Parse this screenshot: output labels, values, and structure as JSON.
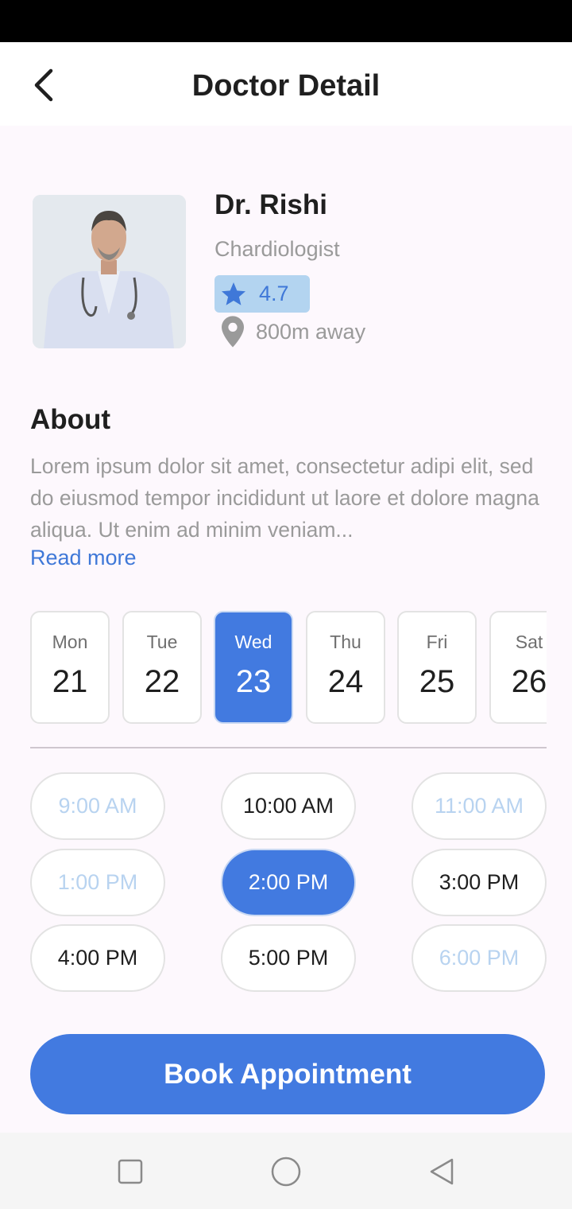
{
  "app_bar": {
    "title": "Doctor Detail",
    "back_icon": "chevron-left-icon"
  },
  "doctor": {
    "name": "Dr. Rishi",
    "specialty": "Chardiologist",
    "rating": "4.7",
    "distance": "800m away",
    "icons": {
      "rating": "star-icon",
      "distance": "location-pin-icon"
    }
  },
  "about": {
    "title": "About",
    "text": "Lorem ipsum dolor sit amet, consectetur adipi elit, sed do eiusmod tempor incididunt ut laore et dolore magna aliqua. Ut enim ad minim veniam...",
    "read_more": "Read more"
  },
  "days": [
    {
      "name": "Mon",
      "num": "21",
      "selected": false
    },
    {
      "name": "Tue",
      "num": "22",
      "selected": false
    },
    {
      "name": "Wed",
      "num": "23",
      "selected": true
    },
    {
      "name": "Thu",
      "num": "24",
      "selected": false
    },
    {
      "name": "Fri",
      "num": "25",
      "selected": false
    },
    {
      "name": "Sat",
      "num": "26",
      "selected": false
    }
  ],
  "time_slots": [
    {
      "label": "9:00 AM",
      "state": "disabled"
    },
    {
      "label": "10:00 AM",
      "state": "available"
    },
    {
      "label": "11:00 AM",
      "state": "disabled"
    },
    {
      "label": "1:00 PM",
      "state": "disabled"
    },
    {
      "label": "2:00 PM",
      "state": "selected"
    },
    {
      "label": "3:00 PM",
      "state": "available"
    },
    {
      "label": "4:00 PM",
      "state": "available"
    },
    {
      "label": "5:00 PM",
      "state": "available"
    },
    {
      "label": "6:00 PM",
      "state": "disabled"
    }
  ],
  "book_button": {
    "label": "Book Appointment"
  },
  "nav_bar": {
    "icons": [
      "square-recents-icon",
      "circle-home-icon",
      "triangle-back-icon"
    ]
  },
  "colors": {
    "accent": "#427ae0",
    "rating_bg": "#b3d4f0",
    "disabled_text": "#b8d3f0",
    "muted_text": "#9a9a9a",
    "page_bg": "#fdf8fd"
  }
}
